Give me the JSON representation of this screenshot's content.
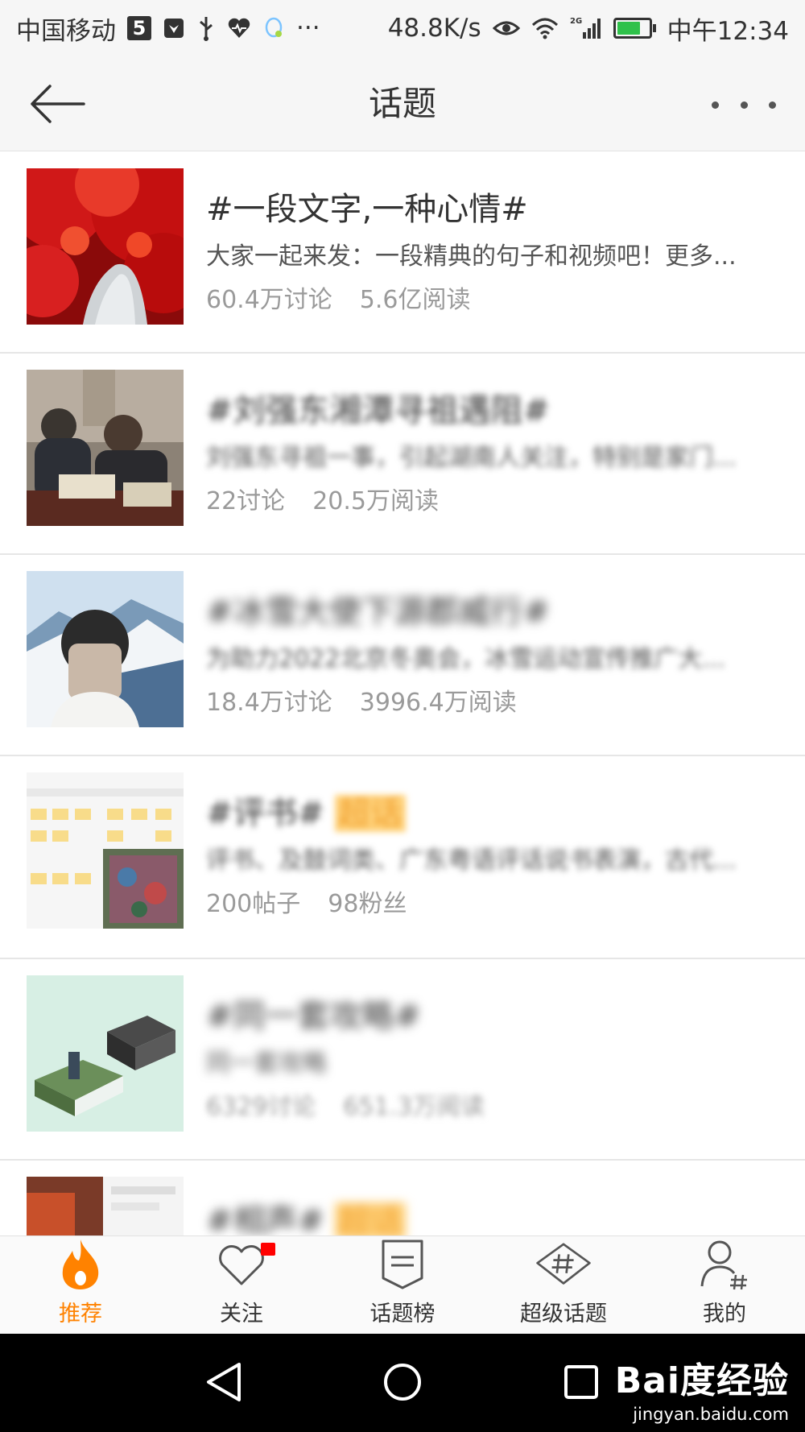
{
  "status_bar": {
    "carrier": "中国移动",
    "sim_badge": "5",
    "more": "···",
    "speed": "48.8K/s",
    "network": "2G",
    "time": "中午12:34",
    "battery_level": 0.75
  },
  "header": {
    "title": "话题",
    "back_icon": "arrow-left-icon",
    "more_icon": "more-dots-icon"
  },
  "topics": [
    {
      "title": "#一段文字,一种心情#",
      "desc": "大家一起来发：一段精典的句子和视频吧！更多...",
      "stat1": "60.4万讨论",
      "stat2": "5.6亿阅读"
    },
    {
      "title": "#刘强东湘潭寻祖遇阻#",
      "desc": "刘强东寻祖一事，引起湖南人关注，特别是家门...",
      "stat1": "22讨论",
      "stat2": "20.5万阅读"
    },
    {
      "title": "#冰雪大使下源郡威行#",
      "desc": "为助力2022北京冬奥会，冰雪运动宣传推广大...",
      "stat1": "18.4万讨论",
      "stat2": "3996.4万阅读"
    },
    {
      "title_prefix": "#评书#",
      "title_tag": "超话",
      "desc": "评书、及鼓词类、广东粤语评话说书表演，古代...",
      "stat1": "200帖子",
      "stat2": "98粉丝"
    },
    {
      "title": "#同一套攻略#",
      "desc": "同一套攻略",
      "stat1": "6329讨论",
      "stat2": "651.3万阅读"
    },
    {
      "title_prefix": "#相声#",
      "title_tag": "超话"
    }
  ],
  "tabs": [
    {
      "label": "推荐",
      "icon": "flame-icon",
      "active": true
    },
    {
      "label": "关注",
      "icon": "heart-icon",
      "active": false,
      "badge": true
    },
    {
      "label": "话题榜",
      "icon": "ranking-icon",
      "active": false
    },
    {
      "label": "超级话题",
      "icon": "hash-diamond-icon",
      "active": false
    },
    {
      "label": "我的",
      "icon": "user-hash-icon",
      "active": false
    }
  ],
  "colors": {
    "accent": "#ff8200",
    "badge": "#ff0000",
    "nav_bg": "#000000"
  },
  "watermark": {
    "main": "Bai度经验",
    "sub": "jingyan.baidu.com"
  }
}
